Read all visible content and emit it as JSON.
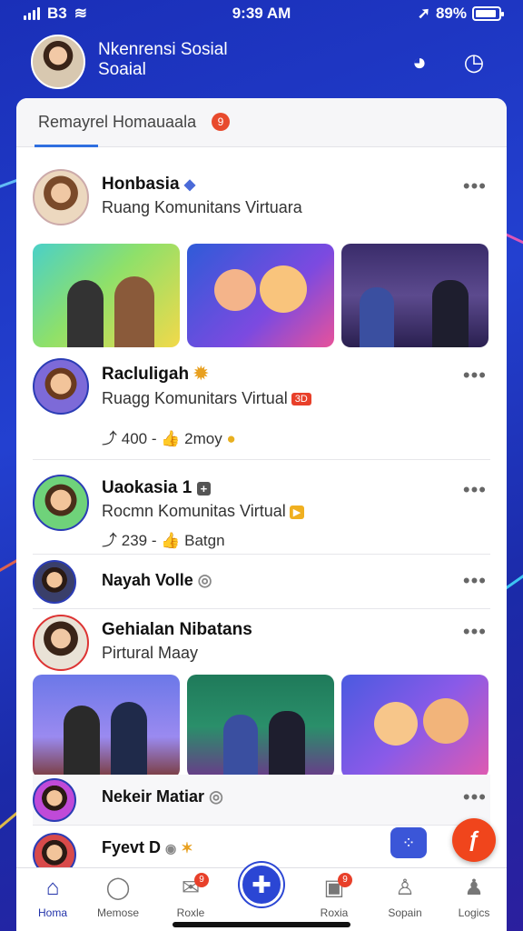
{
  "status_bar": {
    "carrier": "B3",
    "time": "9:39 AM",
    "battery": "89%"
  },
  "header": {
    "title": "Nkenrensi Sosial Soaial"
  },
  "card_tab": {
    "label": "Remayrel Homauaala",
    "badge": "9"
  },
  "posts": [
    {
      "name": "Honbasia",
      "subtitle": "Ruang Komunitans Virtuara"
    },
    {
      "name": "Racluligah",
      "subtitle": "Ruagg Komunitars Virtual",
      "tag": "3D",
      "stats_left": "400",
      "stats_right": "2moy"
    },
    {
      "name": "Uaokasia 1",
      "subtitle": "Rocmn Komunitas Virtual",
      "stats_left": "239",
      "stats_right": "Batgn"
    },
    {
      "name": "Nayah Volle"
    },
    {
      "name": "Gehialan Nibatans",
      "subtitle": "Pirtural Maay"
    },
    {
      "name": "Nekeir Matiar"
    },
    {
      "name": "Fyevt D"
    }
  ],
  "nav": [
    {
      "label": "Homa",
      "icon": "home-icon"
    },
    {
      "label": "Memose",
      "icon": "chat-icon"
    },
    {
      "label": "Roxle",
      "icon": "message-icon",
      "badge": "9"
    },
    {
      "label": "Roxia",
      "icon": "book-icon",
      "badge": "9"
    },
    {
      "label": "Sopain",
      "icon": "person-icon"
    },
    {
      "label": "Logics",
      "icon": "profile-icon"
    }
  ],
  "colors": {
    "accent": "#2b46d4",
    "fab": "#f0451c",
    "badge": "#e84a2d"
  }
}
